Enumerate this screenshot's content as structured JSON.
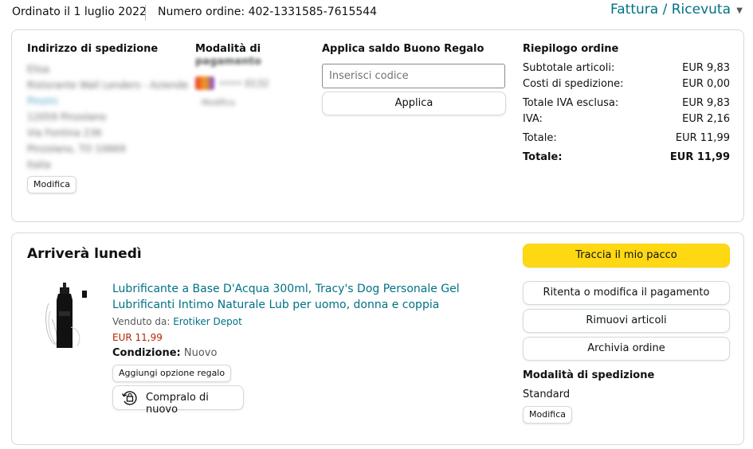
{
  "header": {
    "order_date": "Ordinato il 1 luglio 2022",
    "order_number": "Numero ordine: 402-1331585-7615544",
    "invoice_link": "Fattura / Ricevuta"
  },
  "shipping_address": {
    "heading": "Indirizzo di spedizione",
    "redacted_lines": [
      "Elisa",
      "Ristorante Wall Lenders - Aziende",
      "Pinzini",
      "12059 Pinzolano",
      "Via Fontina 236",
      "Pinzolano, TO 10669",
      "Italia"
    ],
    "edit_button": "Modifica"
  },
  "payment": {
    "heading": "Modalità di pagamento",
    "heading_line1": "Modalità di",
    "heading_line2": "pagamento",
    "redacted_card": "•••• 0132",
    "redacted_extra": "Modifica"
  },
  "gift_card": {
    "heading": "Applica saldo Buono Regalo",
    "input_placeholder": "Inserisci codice",
    "apply_button": "Applica"
  },
  "summary": {
    "heading": "Riepilogo ordine",
    "rows": [
      {
        "label": "Subtotale articoli:",
        "value": "EUR 9,83"
      },
      {
        "label": "Costi di spedizione:",
        "value": "EUR 0,00"
      },
      {
        "label": "Totale IVA esclusa:",
        "value": "EUR 9,83"
      },
      {
        "label": "IVA:",
        "value": "EUR 2,16"
      },
      {
        "label": "Totale:",
        "value": "EUR 11,99"
      },
      {
        "label": "Totale:",
        "value": "EUR 11,99"
      }
    ]
  },
  "shipment": {
    "heading": "Arriverà lunedì",
    "product": {
      "title": "Lubrificante a Base D'Acqua 300ml, Tracy's Dog Personale Gel Lubrificanti Intimo Naturale Lub per uomo, donna e coppia",
      "seller_label": "Venduto da:",
      "seller_name": "Erotiker Depot",
      "price": "EUR 11,99",
      "condition_label": "Condizione:",
      "condition_value": "Nuovo",
      "gift_button": "Aggiungi opzione regalo",
      "buy_again_button": "Compralo di nuovo"
    },
    "actions": {
      "track": "Traccia il mio pacco",
      "retry_payment": "Ritenta o modifica il pagamento",
      "remove_items": "Rimuovi articoli",
      "archive": "Archivia ordine"
    },
    "shipping_method": {
      "heading": "Modalità di spedizione",
      "value": "Standard",
      "edit_button": "Modifica"
    }
  },
  "colors": {
    "link": "#007185",
    "price": "#b12704",
    "primary_button": "#ffd814",
    "border": "#d5d9d9"
  }
}
